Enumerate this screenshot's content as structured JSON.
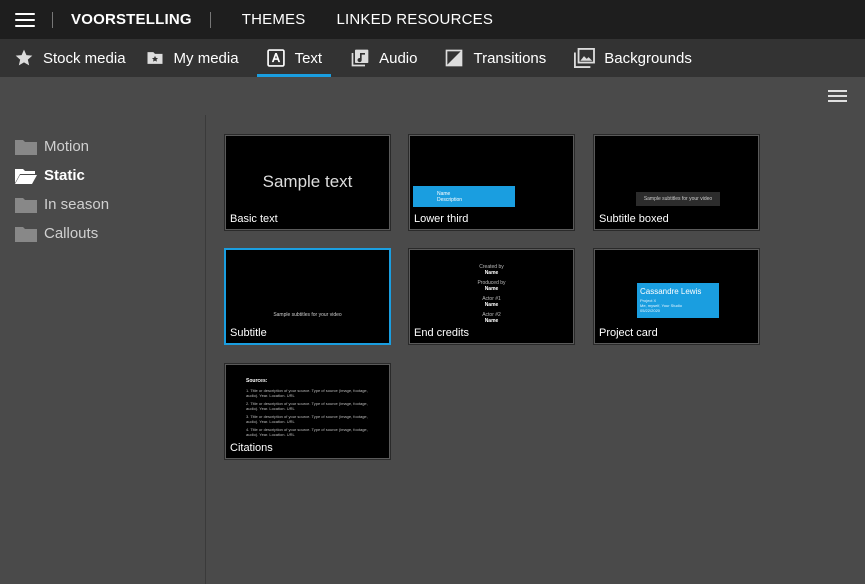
{
  "topbar": {
    "project_title": "VOORSTELLING",
    "links": [
      "THEMES",
      "LINKED RESOURCES"
    ]
  },
  "tabs": [
    {
      "label": "Stock media",
      "icon": "star-icon"
    },
    {
      "label": "My media",
      "icon": "media-folder-icon"
    },
    {
      "label": "Text",
      "icon": "text-icon",
      "active": true
    },
    {
      "label": "Audio",
      "icon": "audio-icon"
    },
    {
      "label": "Transitions",
      "icon": "transitions-icon"
    },
    {
      "label": "Backgrounds",
      "icon": "image-icon"
    }
  ],
  "sidebar": {
    "folders": [
      {
        "label": "Motion"
      },
      {
        "label": "Static",
        "active": true
      },
      {
        "label": "In season"
      },
      {
        "label": "Callouts"
      }
    ]
  },
  "templates": [
    {
      "label": "Basic text",
      "preview_text": "Sample text"
    },
    {
      "label": "Lower third",
      "preview_name": "Name",
      "preview_desc": "Description"
    },
    {
      "label": "Subtitle boxed",
      "preview_text": "Sample subtitles for your video"
    },
    {
      "label": "Subtitle",
      "preview_text": "Sample subtitles for your video",
      "selected": true
    },
    {
      "label": "End credits",
      "credits": [
        {
          "role": "Created by",
          "name": "Name"
        },
        {
          "role": "Produced by",
          "name": "Name"
        },
        {
          "role": "Actor #1",
          "name": "Name"
        },
        {
          "role": "Actor #2",
          "name": "Name"
        }
      ]
    },
    {
      "label": "Project card",
      "card_name": "Cassandre Lewis",
      "card_lines": [
        "Project X",
        "Me, myself, Your Studio",
        "05/22/2020"
      ]
    },
    {
      "label": "Citations",
      "cite_title": "Sources:",
      "cite_lines": [
        "1. Title or description of your source. Type of source (image, footage, audio). Year. Location. URL",
        "2. Title or description of your source. Type of source (image, footage, audio). Year. Location. URL",
        "3. Title or description of your source. Type of source (image, footage, audio). Year. Location. URL",
        "4. Title or description of your source. Type of source (image, footage, audio). Year. Location. URL"
      ]
    }
  ],
  "colors": {
    "accent": "#1a9ee0",
    "topbar": "#1e1e1e",
    "tabbar": "#333333",
    "panel": "#4a4a4a"
  }
}
